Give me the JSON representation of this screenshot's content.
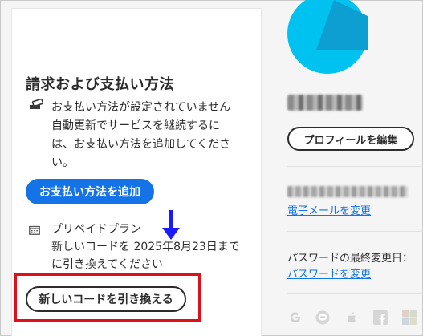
{
  "billing": {
    "title": "請求および支払い方法",
    "notice_line1": "お支払い方法が設定されていません",
    "notice_line2": "自動更新でサービスを継続するに",
    "notice_line3": "は、お支払い方法を追加してくださ",
    "notice_line4": "い。",
    "add_payment_label": "お支払い方法を追加",
    "prepaid_line1": "プリペイドプラン",
    "prepaid_line2": "新しいコードを 2025年8月23日まで",
    "prepaid_line3": "に引き換えてください",
    "redeem_label": "新しいコードを引き換える"
  },
  "profile": {
    "edit_label": "プロフィールを編集",
    "change_email_label": "電子メールを変更",
    "password_label": "パスワードの最終変更日：",
    "change_password_label": "パスワードを変更"
  },
  "colors": {
    "accent": "#1473e6",
    "highlight": "#e0101b",
    "annotation_arrow": "#1a1aff",
    "avatar": "#00c2f0"
  },
  "icons": [
    "credit-card-icon",
    "calendar-icon",
    "google-icon",
    "line-icon",
    "apple-icon",
    "facebook-icon",
    "microsoft-icon"
  ]
}
